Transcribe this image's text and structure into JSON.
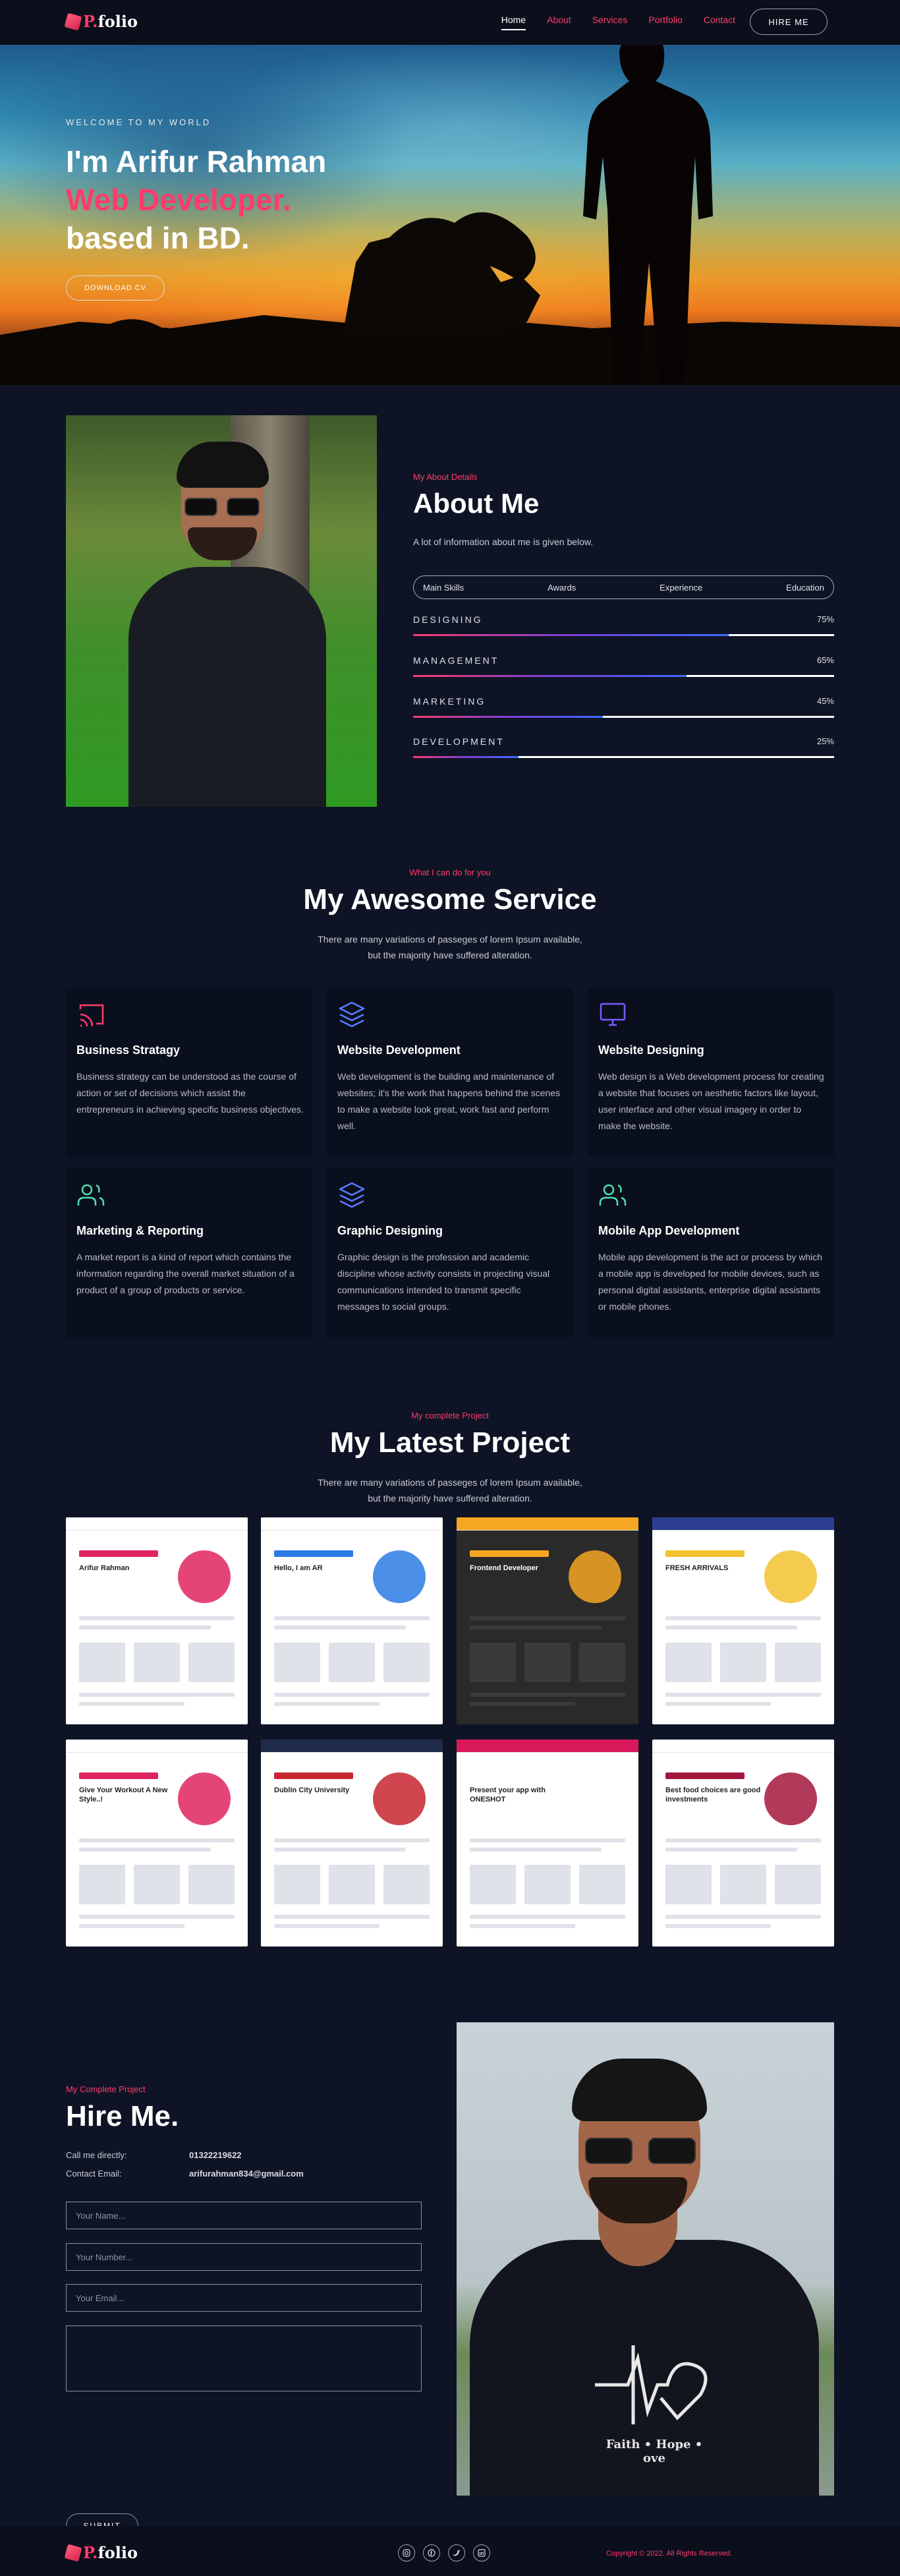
{
  "nav": {
    "logo_mark": "P.",
    "logo_text": "folio",
    "links": [
      "Home",
      "About",
      "Services",
      "Portfolio",
      "Contact"
    ],
    "hire_button": "HIRE ME"
  },
  "hero": {
    "welcome": "WELCOME TO MY WORLD",
    "line1": "I'm Arifur Rahman",
    "line2": "Web Developer.",
    "line3": "based in BD.",
    "cta": "DOWNLOAD CV"
  },
  "about": {
    "kicker": "My About Details",
    "title": "About Me",
    "description": "A lot of information about me is given below.",
    "tabs": [
      "Main Skills",
      "Awards",
      "Experience",
      "Education"
    ],
    "skills": [
      {
        "name": "DESIGNING",
        "percent_label": "75%",
        "level": 0.75
      },
      {
        "name": "MANAGEMENT",
        "percent_label": "65%",
        "level": 0.65
      },
      {
        "name": "MARKETING",
        "percent_label": "45%",
        "level": 0.45
      },
      {
        "name": "DEVELOPMENT",
        "percent_label": "25%",
        "level": 0.25
      }
    ]
  },
  "services": {
    "kicker": "What I can do for you",
    "title": "My Awesome Service",
    "subtitle_line1": "There are many variations of passeges of lorem Ipsum available,",
    "subtitle_line2": "but the majority have suffered alteration.",
    "items": [
      {
        "title": "Business Stratagy",
        "icon": "cast-icon",
        "color": "#ff3b6b",
        "text": "Business strategy can be understood as the course of action or set of decisions which assist the entrepreneurs in achieving specific business objectives."
      },
      {
        "title": "Website Development",
        "icon": "layers-icon",
        "color": "#5b7cff",
        "text": "Web development is the building and maintenance of websites; it's the work that happens behind the scenes to make a website look great, work fast and perform well."
      },
      {
        "title": "Website Designing",
        "icon": "monitor-icon",
        "color": "#7b5cff",
        "text": "Web design is a Web development process for creating a website that focuses on aesthetic factors like layout, user interface and other visual imagery in order to make the website."
      },
      {
        "title": "Marketing & Reporting",
        "icon": "users-icon",
        "color": "#4fe0b0",
        "text": "A market report is a kind of report which contains the information regarding the overall market situation of a product of a group of products or service."
      },
      {
        "title": "Graphic Designing",
        "icon": "layers-icon",
        "color": "#5b7cff",
        "text": "Graphic design is the profession and academic discipline whose activity consists in projecting visual communications intended to transmit specific messages to social groups."
      },
      {
        "title": "Mobile App Development",
        "icon": "users-icon",
        "color": "#4fe0b0",
        "text": "Mobile app development is the act or process by which a mobile app is developed for mobile devices, such as personal digital assistants, enterprise digital assistants or mobile phones."
      }
    ]
  },
  "projects": {
    "kicker": "My complete Project",
    "title": "My Latest Project",
    "subtitle_line1": "There are many variations of passeges of lorem Ipsum available,",
    "subtitle_line2": "but the majority have suffered alteration.",
    "thumbs": [
      {
        "bar": "#ffffff",
        "accent": "#e0245e",
        "bg": "#ffffff",
        "caption": "Arifur Rahman"
      },
      {
        "bar": "#ffffff",
        "accent": "#2d7be5",
        "bg": "#ffffff",
        "caption": "Hello, I am AR"
      },
      {
        "bar": "#f6a623",
        "accent": "#f6a623",
        "bg": "#2a2a2a",
        "caption": "Frontend Developer"
      },
      {
        "bar": "#2c3e8f",
        "accent": "#f2c230",
        "bg": "#ffffff",
        "caption": "FRESH ARRIVALS"
      },
      {
        "bar": "#ffffff",
        "accent": "#e0245e",
        "bg": "#ffffff",
        "caption": "Give Your Workout A New Style..!"
      },
      {
        "bar": "#1f2a48",
        "accent": "#c8262f",
        "bg": "#ffffff",
        "caption": "Dublin City University"
      },
      {
        "bar": "#d9185b",
        "accent": "#ffffff",
        "bg": "#ffffff",
        "caption": "Present your app with ONESHOT"
      },
      {
        "bar": "#ffffff",
        "accent": "#a3173e",
        "bg": "#ffffff",
        "caption": "Best food choices are good investments"
      }
    ]
  },
  "hire": {
    "kicker": "My Complete Project",
    "title": "Hire Me.",
    "phone_label": "Call me directly:",
    "phone": "01322219622",
    "email_label": "Contact Email:",
    "email": "arifurahman834@gmail.com",
    "name_placeholder": "Your Name...",
    "number_placeholder": "Your Number...",
    "email_placeholder": "Your Email...",
    "shirt_text": "Faith • Hope • ove",
    "submit": "SUBMIT"
  },
  "footer": {
    "logo_mark": "P.",
    "logo_text": "folio",
    "social": [
      "instagram-icon",
      "facebook-icon",
      "twitter-icon",
      "linkedin-icon"
    ],
    "copyright": "Copyright © 2022. All Rights Reserved."
  }
}
